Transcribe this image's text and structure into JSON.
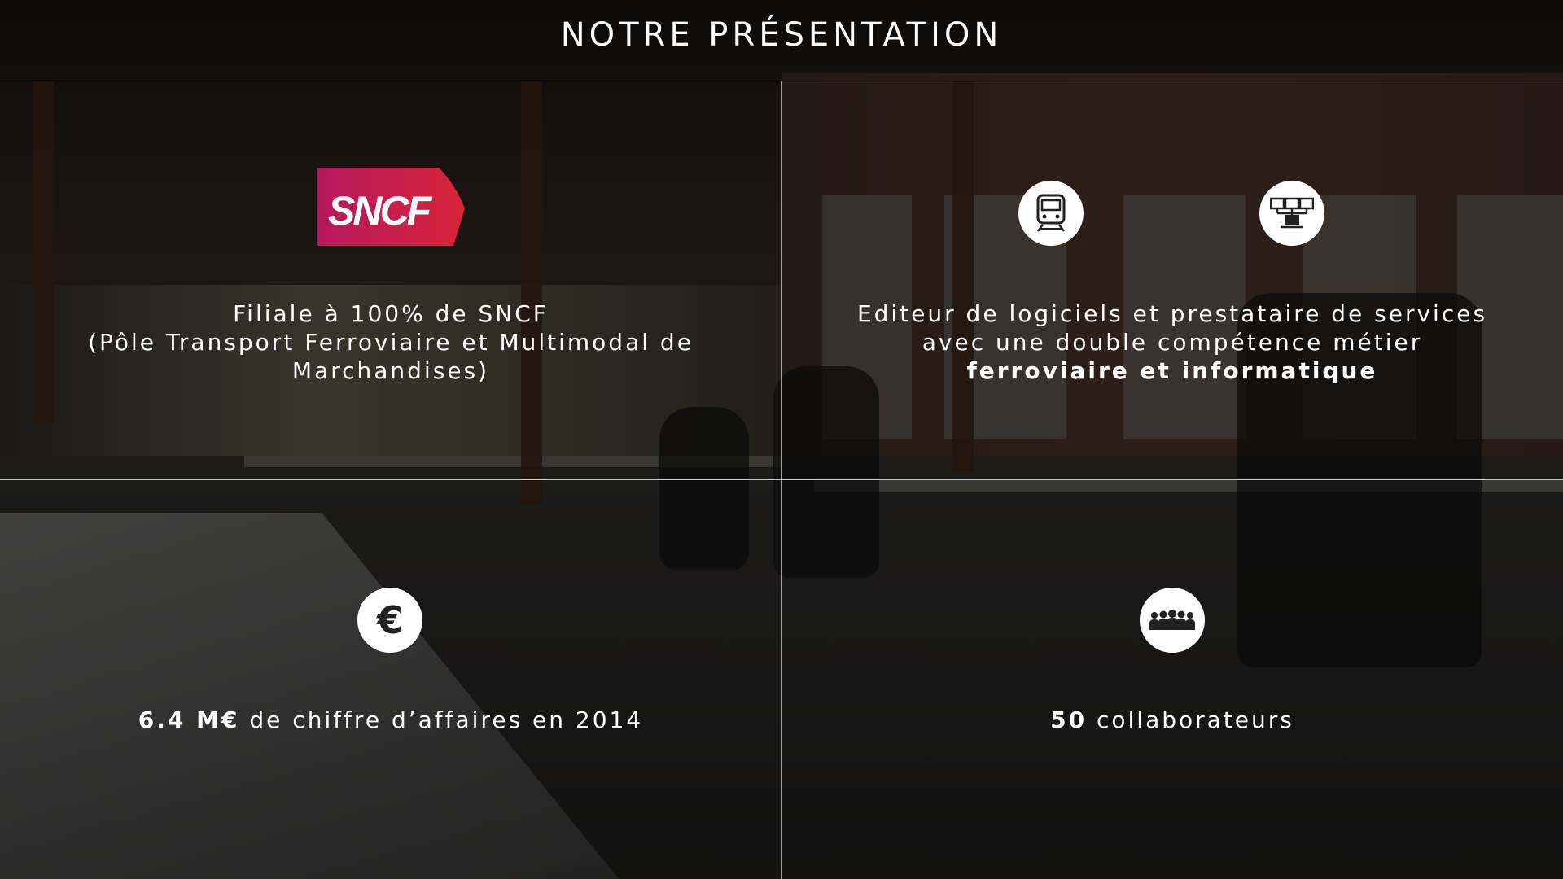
{
  "title": "NOTRE PRÉSENTATION",
  "top_left": {
    "logo_text": "SNCF",
    "lines": [
      "Filiale à 100% de SNCF",
      "(Pôle Transport Ferroviaire et Multimodal de",
      "Marchandises)"
    ]
  },
  "top_right": {
    "icons": [
      "train-icon",
      "network-computers-icon"
    ],
    "line1": "Editeur de logiciels et prestataire de services",
    "line2": "avec une double compétence métier",
    "line3_bold": "ferroviaire et informatique"
  },
  "bottom_left": {
    "icon": "euro-icon",
    "value": "6.4 M€",
    "rest": " de chiffre d’affaires en 2014"
  },
  "bottom_right": {
    "icon": "people-group-icon",
    "value": "50",
    "rest": " collaborateurs"
  },
  "colors": {
    "sncf_gradient_start": "#b5185e",
    "sncf_gradient_end": "#d8243a",
    "text": "#ffffff"
  }
}
